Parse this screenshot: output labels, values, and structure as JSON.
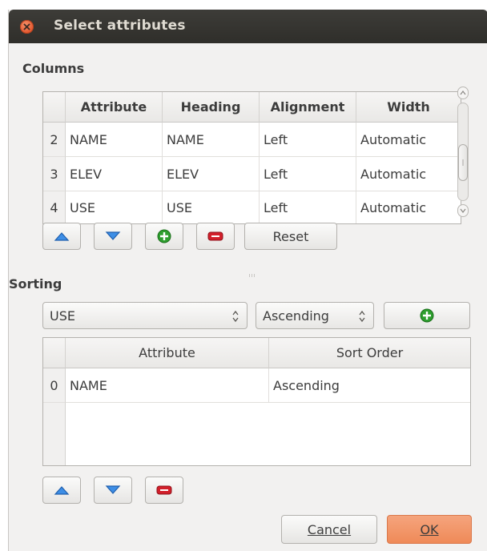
{
  "dialog": {
    "title": "Select attributes"
  },
  "columns": {
    "label": "Columns",
    "headers": [
      "Attribute",
      "Heading",
      "Alignment",
      "Width"
    ],
    "rows": [
      {
        "num": "2",
        "attribute": "NAME",
        "heading": "NAME",
        "alignment": "Left",
        "width": "Automatic"
      },
      {
        "num": "3",
        "attribute": "ELEV",
        "heading": "ELEV",
        "alignment": "Left",
        "width": "Automatic"
      },
      {
        "num": "4",
        "attribute": "USE",
        "heading": "USE",
        "alignment": "Left",
        "width": "Automatic"
      }
    ],
    "buttons": {
      "reset": "Reset"
    }
  },
  "sorting": {
    "label": "Sorting",
    "attribute_combo": "USE",
    "order_combo": "Ascending",
    "headers": [
      "Attribute",
      "Sort Order"
    ],
    "rows": [
      {
        "num": "0",
        "attribute": "NAME",
        "sort_order": "Ascending"
      }
    ]
  },
  "footer": {
    "cancel": "Cancel",
    "ok": "OK"
  },
  "colors": {
    "accent": "#ef8a58",
    "titlebar": "#3d3c38",
    "add_green": "#2e9e2e",
    "remove_red": "#d21f2a",
    "move_blue": "#2f7fdd"
  }
}
